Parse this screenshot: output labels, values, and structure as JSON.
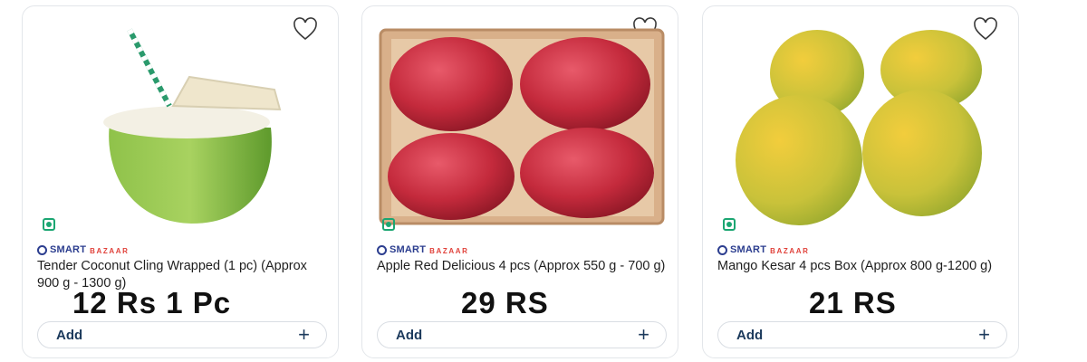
{
  "products": [
    {
      "brand_smart": "SMART",
      "brand_bazaar": "BAZAAR",
      "title": "Tender Coconut Cling Wrapped (1 pc) (Approx 900 g - 1300 g)",
      "price": "12 Rs 1 Pc",
      "add_label": "Add",
      "add_icon": "+"
    },
    {
      "brand_smart": "SMART",
      "brand_bazaar": "BAZAAR",
      "title": "Apple Red Delicious 4 pcs (Approx 550 g - 700 g)",
      "price": "29 RS",
      "add_label": "Add",
      "add_icon": "+"
    },
    {
      "brand_smart": "SMART",
      "brand_bazaar": "BAZAAR",
      "title": "Mango Kesar 4 pcs Box (Approx 800 g-1200 g)",
      "price": "21 RS",
      "add_label": "Add",
      "add_icon": "+"
    }
  ],
  "colors": {
    "veg_indicator": "#1ba672",
    "brand_smart": "#2c3e8f",
    "brand_bazaar": "#e0413a",
    "add_text": "#1c3a5c",
    "card_border": "#e3e6ea"
  },
  "icons": [
    "wishlist-heart-icon",
    "veg-indicator-icon",
    "smart-bazaar-logo",
    "plus-icon"
  ]
}
